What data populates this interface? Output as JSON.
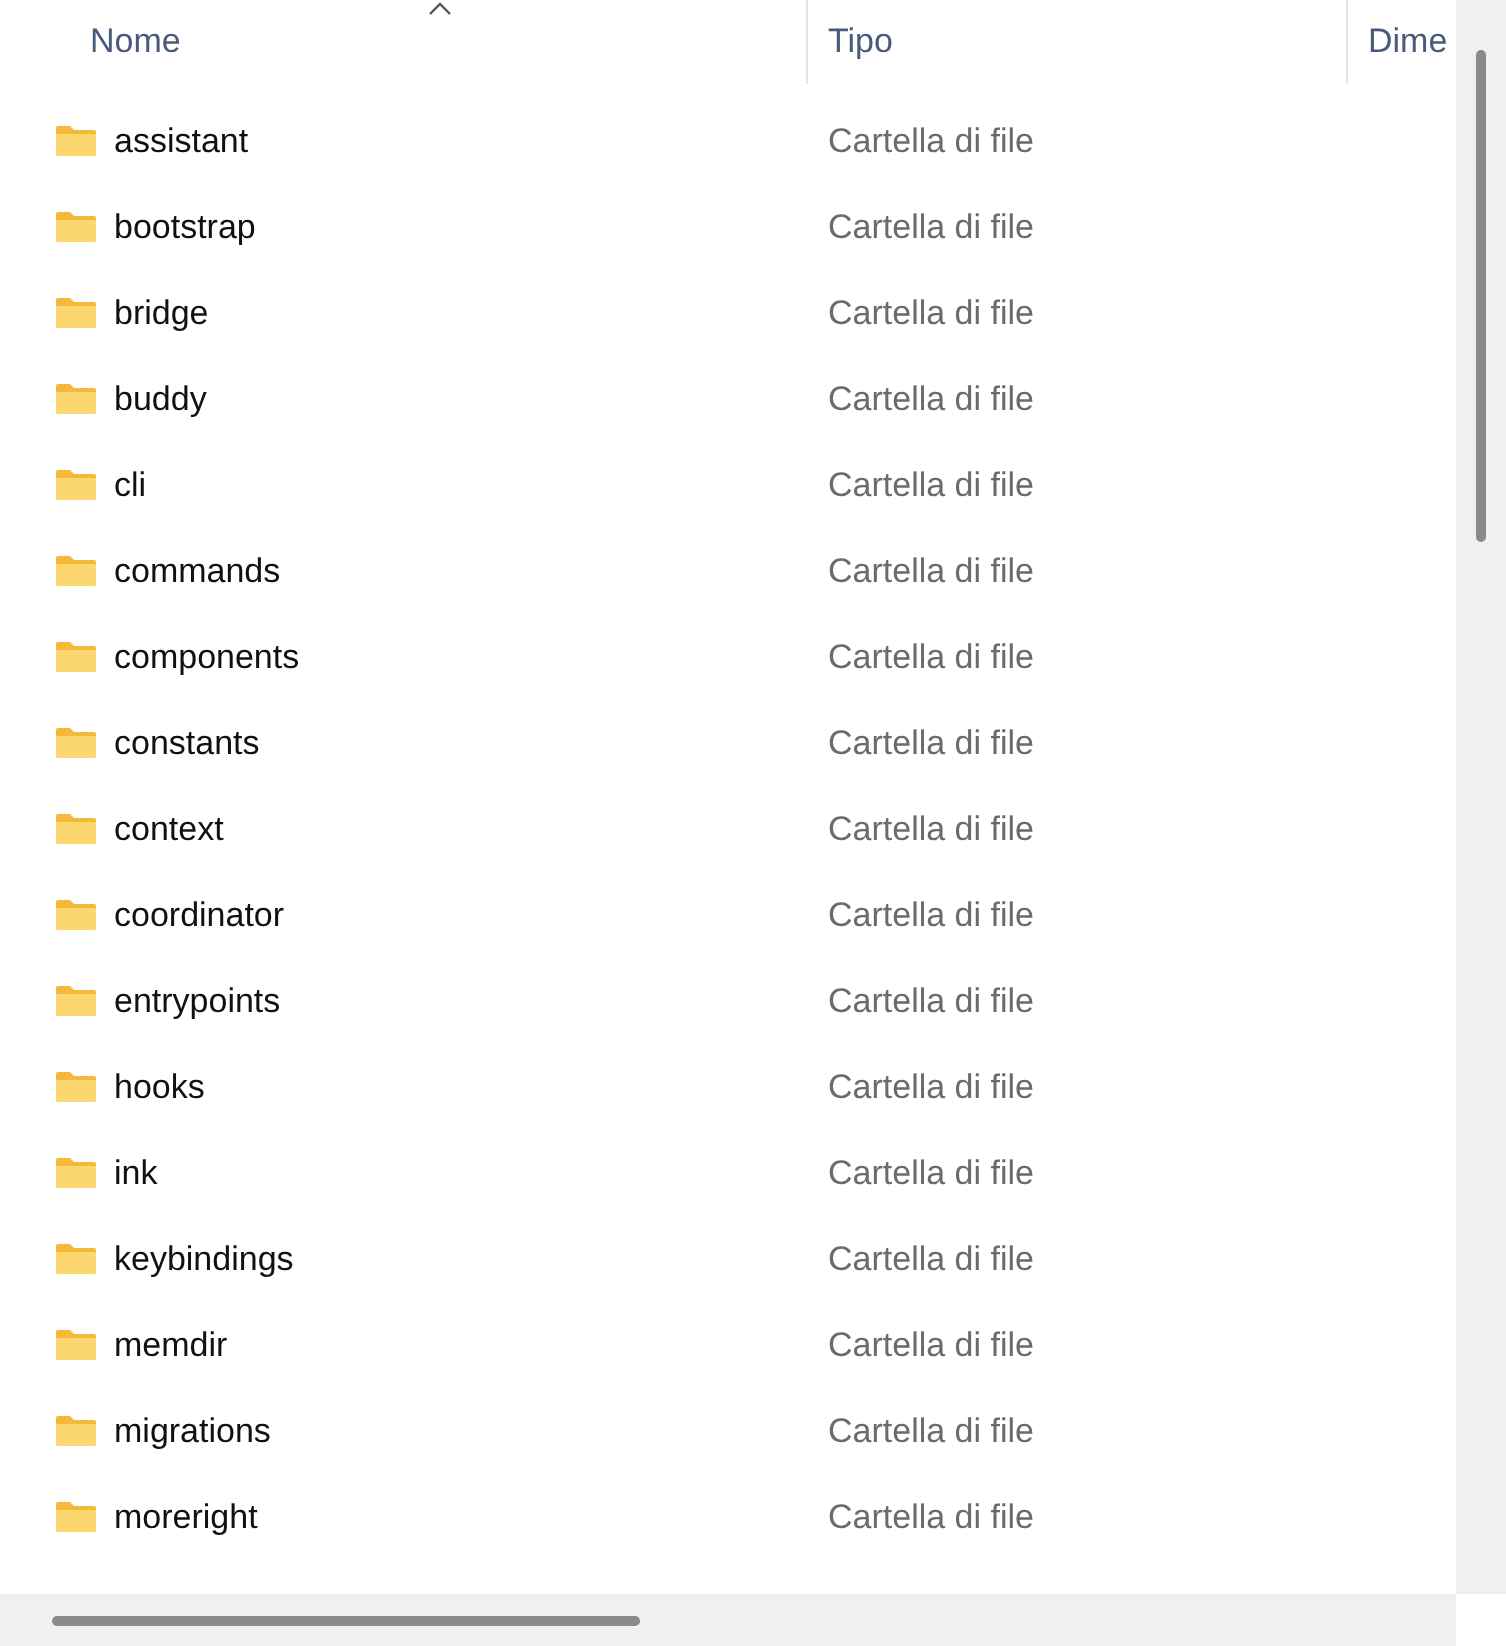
{
  "columns": [
    {
      "label": "Nome",
      "sorted": true
    },
    {
      "label": "Tipo",
      "sorted": false
    },
    {
      "label": "Dime",
      "sorted": false
    }
  ],
  "rows": [
    {
      "name": "assistant",
      "type": "Cartella di file"
    },
    {
      "name": "bootstrap",
      "type": "Cartella di file"
    },
    {
      "name": "bridge",
      "type": "Cartella di file"
    },
    {
      "name": "buddy",
      "type": "Cartella di file"
    },
    {
      "name": "cli",
      "type": "Cartella di file"
    },
    {
      "name": "commands",
      "type": "Cartella di file"
    },
    {
      "name": "components",
      "type": "Cartella di file"
    },
    {
      "name": "constants",
      "type": "Cartella di file"
    },
    {
      "name": "context",
      "type": "Cartella di file"
    },
    {
      "name": "coordinator",
      "type": "Cartella di file"
    },
    {
      "name": "entrypoints",
      "type": "Cartella di file"
    },
    {
      "name": "hooks",
      "type": "Cartella di file"
    },
    {
      "name": "ink",
      "type": "Cartella di file"
    },
    {
      "name": "keybindings",
      "type": "Cartella di file"
    },
    {
      "name": "memdir",
      "type": "Cartella di file"
    },
    {
      "name": "migrations",
      "type": "Cartella di file"
    },
    {
      "name": "moreright",
      "type": "Cartella di file"
    }
  ]
}
